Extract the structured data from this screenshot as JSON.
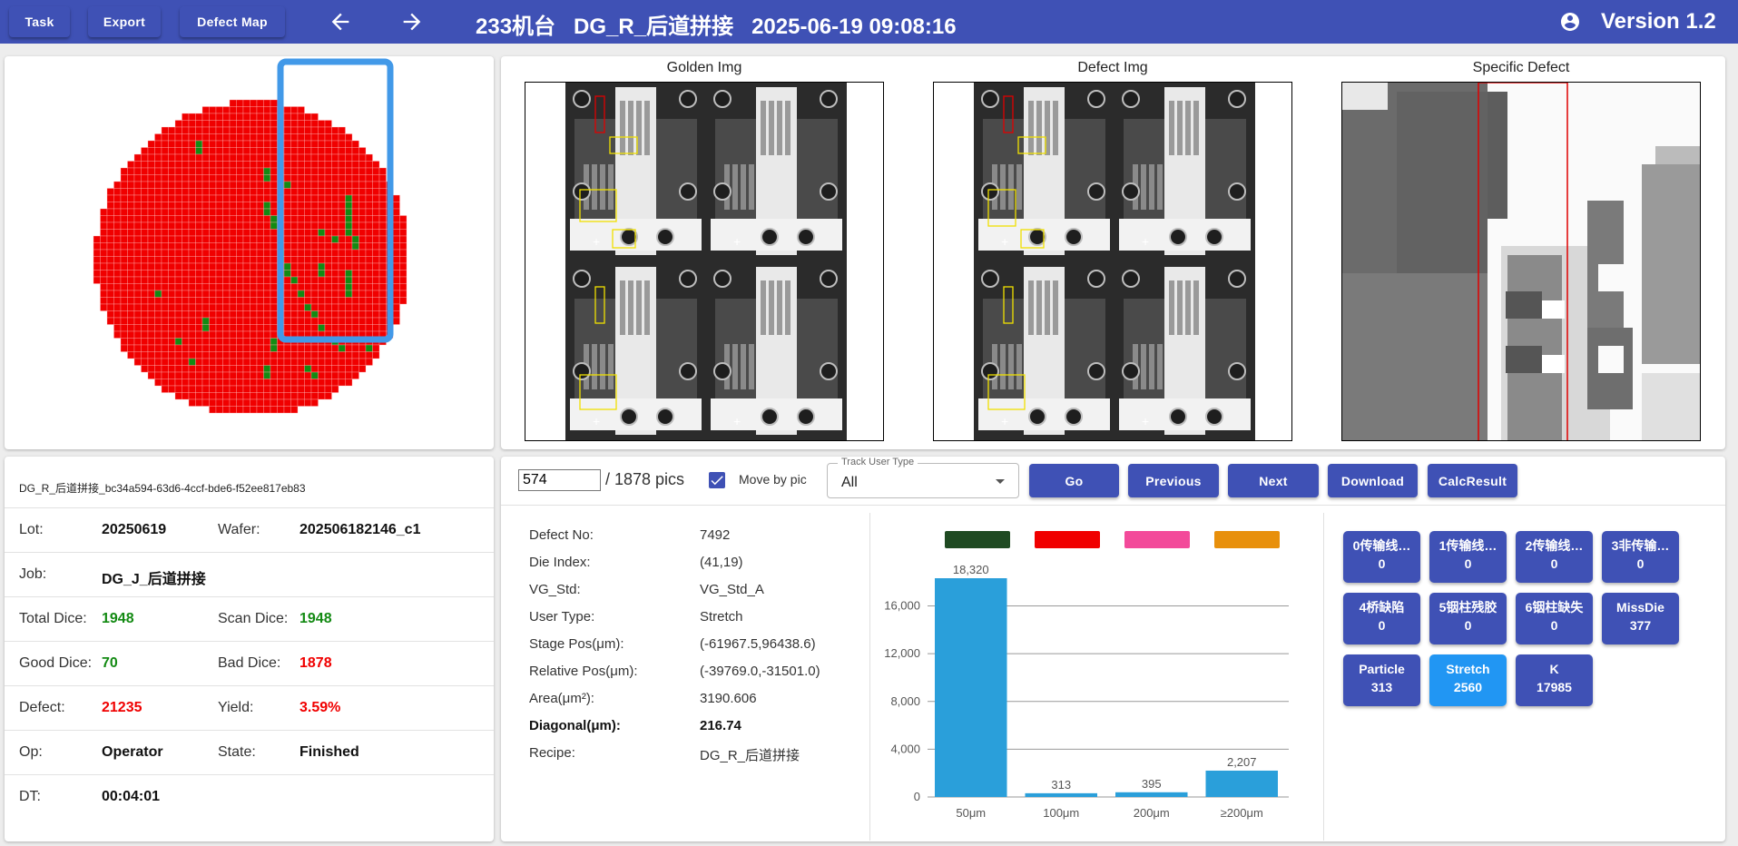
{
  "toolbar": {
    "task_label": "Task",
    "export_label": "Export",
    "defect_map_label": "Defect Map",
    "title": "233机台   DG_R_后道拼接   2025-06-19 09:08:16",
    "version": "Version 1.2"
  },
  "images": {
    "golden_title": "Golden Img",
    "defect_title": "Defect Img",
    "specific_title": "Specific Defect"
  },
  "info": {
    "lot_id": "DG_R_后道拼接_bc34a594-63d6-4ccf-bde6-f52ee817eb83",
    "lot_label": "Lot:",
    "lot_value": "20250619",
    "wafer_label": "Wafer:",
    "wafer_value": "202506182146_c1",
    "job_label": "Job:",
    "job_value": "DG_J_后道拼接",
    "total_dice_label": "Total Dice:",
    "total_dice_value": "1948",
    "scan_dice_label": "Scan Dice:",
    "scan_dice_value": "1948",
    "good_dice_label": "Good Dice:",
    "good_dice_value": "70",
    "bad_dice_label": "Bad Dice:",
    "bad_dice_value": "1878",
    "defect_label": "Defect:",
    "defect_value": "21235",
    "yield_label": "Yield:",
    "yield_value": "3.59%",
    "op_label": "Op:",
    "op_value": "Operator",
    "state_label": "State:",
    "state_value": "Finished",
    "dt_label": "DT:",
    "dt_value": "00:04:01"
  },
  "controls": {
    "pic_index": "574",
    "pic_total": "/ 1878 pics",
    "move_by_pic_label": "Move by pic",
    "move_by_pic_checked": true,
    "track_legend": "Track User Type",
    "track_value": "All",
    "go_label": "Go",
    "previous_label": "Previous",
    "next_label": "Next",
    "download_label": "Download",
    "calc_label": "CalcResult"
  },
  "defect": {
    "no_label": "Defect No:",
    "no_value": "7492",
    "die_label": "Die Index:",
    "die_value": "(41,19)",
    "vg_label": "VG_Std:",
    "vg_value": "VG_Std_A",
    "user_label": "User Type:",
    "user_value": "Stretch",
    "stage_label": "Stage Pos(μm):",
    "stage_value": "(-61967.5,96438.6)",
    "relative_label": "Relative Pos(μm):",
    "relative_value": "(-39769.0,-31501.0)",
    "area_label": "Area(μm²):",
    "area_value": "3190.606",
    "diagonal_label": "Diagonal(μm):",
    "diagonal_value": "216.74",
    "recipe_label": "Recipe:",
    "recipe_value": "DG_R_后道拼接"
  },
  "chart_data": {
    "type": "bar",
    "categories": [
      "50μm",
      "100μm",
      "200μm",
      "≥200μm"
    ],
    "values": [
      18320,
      313,
      395,
      2207
    ],
    "value_labels": [
      "18,320",
      "313",
      "395",
      "2,207"
    ],
    "yticks": [
      "0",
      "4,000",
      "8,000",
      "12,000",
      "16,000"
    ],
    "ylim": [
      0,
      18320
    ],
    "legend_colors": [
      "#1f4a22",
      "#f00000",
      "#f34a9a",
      "#e8900c"
    ],
    "bar_color": "#2a9fda",
    "grid": true
  },
  "categories": [
    {
      "name": "0传输线…",
      "count": "0",
      "active": false
    },
    {
      "name": "1传输线…",
      "count": "0",
      "active": false
    },
    {
      "name": "2传输线…",
      "count": "0",
      "active": false
    },
    {
      "name": "3非传输…",
      "count": "0",
      "active": false
    },
    {
      "name": "4桥缺陷",
      "count": "0",
      "active": false
    },
    {
      "name": "5铟柱残胶",
      "count": "0",
      "active": false
    },
    {
      "name": "6铟柱缺失",
      "count": "0",
      "active": false
    },
    {
      "name": "MissDie",
      "count": "377",
      "active": false
    },
    {
      "name": "Particle",
      "count": "313",
      "active": false
    },
    {
      "name": "Stretch",
      "count": "2560",
      "active": true
    },
    {
      "name": "K",
      "count": "17985",
      "active": false
    }
  ],
  "colors": {
    "primary": "#3f51b5",
    "selected": "#2196f3",
    "bad_die": "#f00000",
    "good_die": "#138a13",
    "current_die": "#1a1acc",
    "selection_box": "#4299e8"
  }
}
